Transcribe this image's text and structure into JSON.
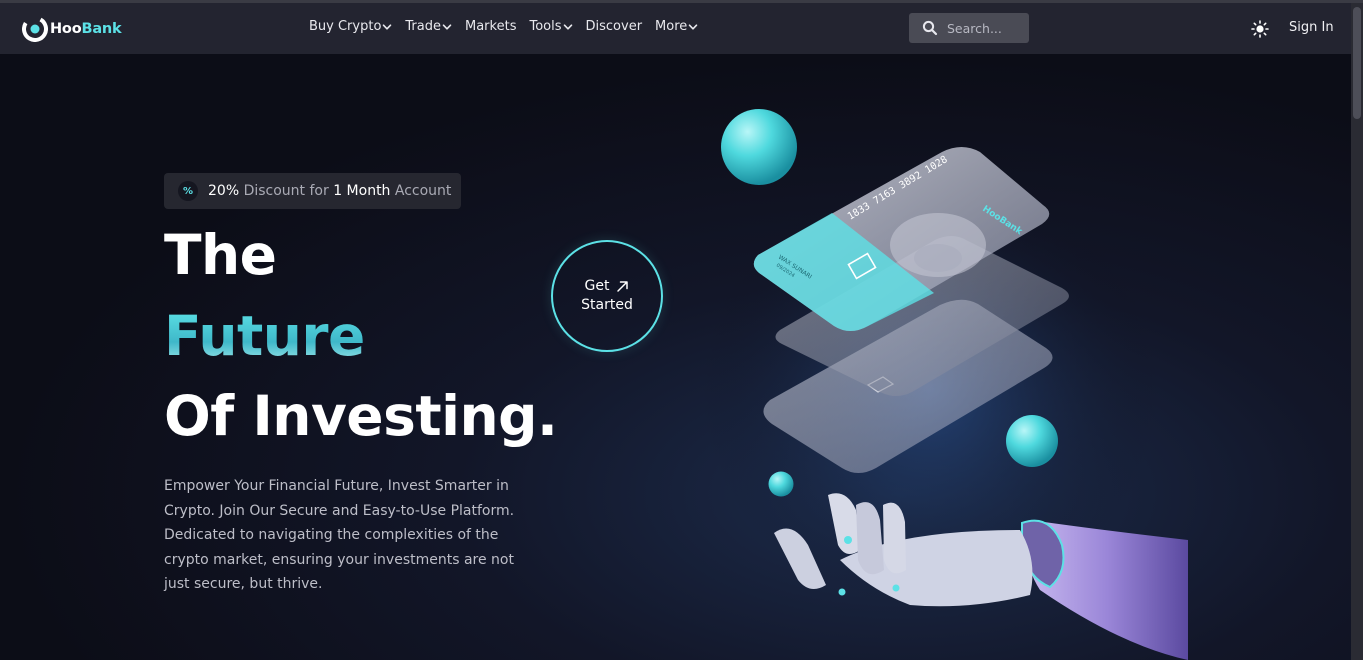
{
  "brand": {
    "name_part1": "Hoo",
    "name_part2": "Bank"
  },
  "nav": {
    "items": [
      {
        "label": "Buy Crypto",
        "has_dropdown": true
      },
      {
        "label": "Trade",
        "has_dropdown": true
      },
      {
        "label": "Markets",
        "has_dropdown": false
      },
      {
        "label": "Tools",
        "has_dropdown": true
      },
      {
        "label": "Discover",
        "has_dropdown": false
      },
      {
        "label": "More",
        "has_dropdown": true
      }
    ],
    "search_placeholder": "Search...",
    "theme_icon": "sun-icon",
    "signin_label": "Sign In"
  },
  "hero": {
    "badge": {
      "icon": "percent-icon",
      "percent": "20%",
      "text1": " Discount for ",
      "duration": "1 Month",
      "text2": " Account"
    },
    "heading_line1": "The",
    "heading_line2": "Future",
    "heading_line3": "Of Investing.",
    "description": "Empower Your Financial Future, Invest Smarter in Crypto. Join Our Secure and Easy-to-Use Platform. Dedicated to navigating the complexities of the crypto market, ensuring your investments are not just secure, but thrive.",
    "cta_line1": "Get",
    "cta_line2": "Started",
    "cta_icon": "arrow-up-right-icon"
  },
  "illustration": {
    "card_number": "1833 7163 3892 1028",
    "card_holder": "WAX SUNARI",
    "card_expiry": "09/2024",
    "card_brand": "HooBank"
  },
  "colors": {
    "accent": "#5ce1e6",
    "navbar_bg": "#232430",
    "page_bg": "#0c0d17",
    "badge_bg": "#262730"
  }
}
